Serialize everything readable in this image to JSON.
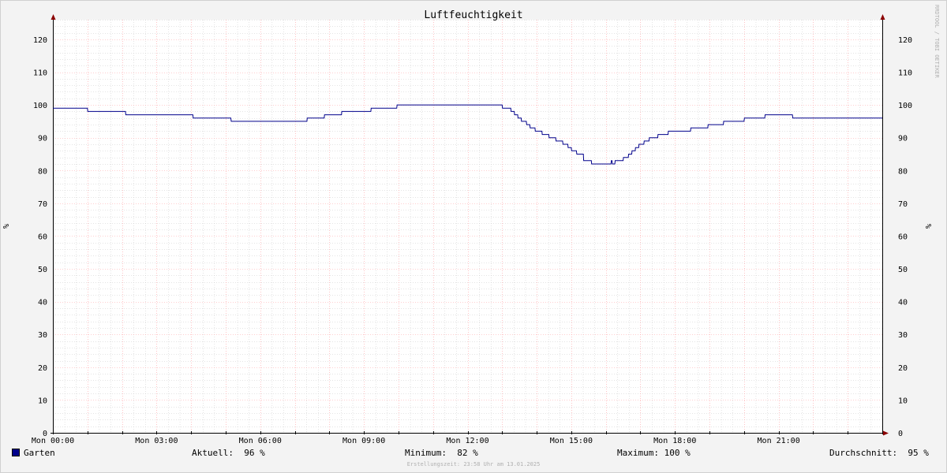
{
  "colors": {
    "line": "#00008b",
    "major_grid": "#ff9da0",
    "minor_grid": "#c8c8c8",
    "axis": "#000000",
    "arrow": "#8b0000"
  },
  "legend": {
    "series_label": "Garten",
    "aktuell": "Aktuell:  96 %",
    "minimum": "Minimum:  82 %",
    "maximum": "Maximum: 100 %",
    "durchschnitt": "Durchschnitt:  95 %"
  },
  "footer": "Erstellungszeit: 23:58 Uhr am 13.01.2025",
  "side_text": "RRDTOOL / TOBI OETIKER",
  "chart_data": {
    "type": "line",
    "title": "Luftfeuchtigkeit",
    "ylabel": "%",
    "ylim": [
      0,
      126
    ],
    "xlim_hours": [
      0,
      24
    ],
    "y_ticks": [
      0,
      10,
      20,
      30,
      40,
      50,
      60,
      70,
      80,
      90,
      100,
      110,
      120
    ],
    "x_ticks": [
      {
        "hour": 0,
        "label": "Mon 00:00"
      },
      {
        "hour": 3,
        "label": "Mon 03:00"
      },
      {
        "hour": 6,
        "label": "Mon 06:00"
      },
      {
        "hour": 9,
        "label": "Mon 09:00"
      },
      {
        "hour": 12,
        "label": "Mon 12:00"
      },
      {
        "hour": 15,
        "label": "Mon 15:00"
      },
      {
        "hour": 18,
        "label": "Mon 18:00"
      },
      {
        "hour": 21,
        "label": "Mon 21:00"
      }
    ],
    "grid": true,
    "series": [
      {
        "name": "Garten",
        "x": [
          0,
          0.1,
          0.11,
          1.0,
          1.01,
          2.1,
          2.11,
          4.05,
          4.06,
          5.15,
          5.16,
          7.35,
          7.36,
          7.85,
          7.86,
          8.35,
          8.36,
          9.2,
          9.21,
          9.95,
          9.96,
          13.0,
          13.01,
          13.25,
          13.26,
          13.35,
          13.36,
          13.45,
          13.46,
          13.55,
          13.56,
          13.7,
          13.71,
          13.8,
          13.81,
          13.95,
          13.96,
          14.15,
          14.16,
          14.35,
          14.36,
          14.55,
          14.56,
          14.75,
          14.76,
          14.9,
          14.91,
          15.0,
          15.01,
          15.15,
          15.16,
          15.35,
          15.36,
          15.58,
          15.59,
          15.62,
          15.63,
          16.15,
          16.16,
          16.18,
          16.19,
          16.26,
          16.27,
          16.5,
          16.51,
          16.65,
          16.66,
          16.75,
          16.76,
          16.85,
          16.86,
          16.95,
          16.96,
          17.1,
          17.11,
          17.25,
          17.26,
          17.5,
          17.51,
          17.8,
          17.81,
          18.45,
          18.46,
          18.95,
          18.96,
          19.4,
          19.41,
          20.0,
          20.01,
          20.6,
          20.61,
          21.4,
          21.41,
          22.2,
          22.21,
          22.75,
          22.76,
          24.0
        ],
        "values": [
          99,
          99,
          99,
          99,
          98,
          98,
          97,
          97,
          96,
          96,
          95,
          95,
          96,
          96,
          97,
          97,
          98,
          98,
          99,
          99,
          100,
          100,
          99,
          99,
          98,
          98,
          97,
          97,
          96,
          96,
          95,
          95,
          94,
          94,
          93,
          93,
          92,
          92,
          91,
          91,
          90,
          90,
          89,
          89,
          88,
          88,
          87,
          87,
          86,
          86,
          85,
          85,
          83,
          83,
          82,
          82,
          82,
          82,
          83,
          83,
          82,
          82,
          83,
          83,
          84,
          84,
          85,
          85,
          86,
          86,
          87,
          87,
          88,
          88,
          89,
          89,
          90,
          90,
          91,
          91,
          92,
          92,
          93,
          93,
          94,
          94,
          95,
          95,
          96,
          96,
          97,
          97,
          96,
          96,
          96,
          96,
          96,
          96
        ]
      }
    ]
  }
}
